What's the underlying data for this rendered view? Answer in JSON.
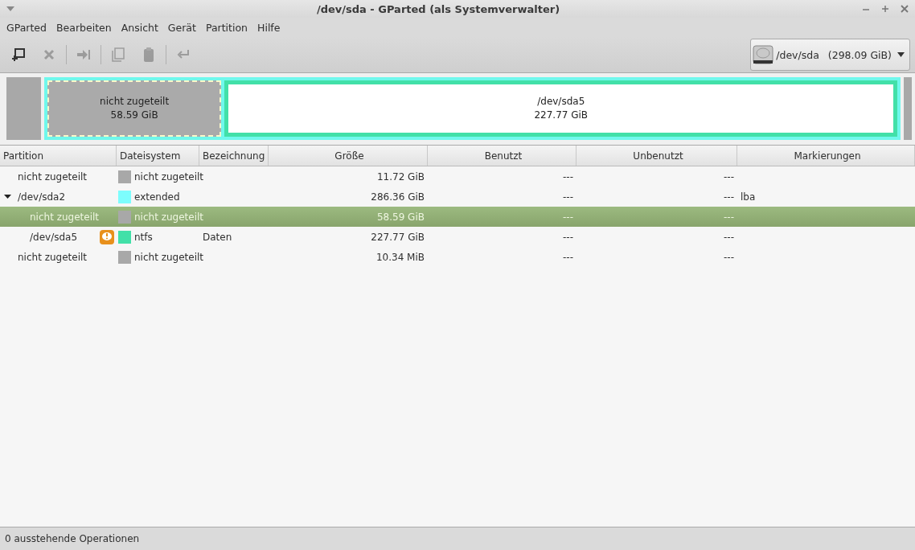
{
  "window": {
    "title": "/dev/sda - GParted (als Systemverwalter)"
  },
  "menu": [
    "GParted",
    "Bearbeiten",
    "Ansicht",
    "Gerät",
    "Partition",
    "Hilfe"
  ],
  "toolbar": [
    {
      "kind": "new",
      "disabled": false
    },
    {
      "kind": "delete",
      "disabled": true
    },
    {
      "kind": "sep"
    },
    {
      "kind": "resize",
      "disabled": true
    },
    {
      "kind": "sep"
    },
    {
      "kind": "copy",
      "disabled": true
    },
    {
      "kind": "paste",
      "disabled": true
    },
    {
      "kind": "sep"
    },
    {
      "kind": "apply",
      "disabled": true
    }
  ],
  "device": {
    "name": "/dev/sda",
    "size": "(298.09 GiB)"
  },
  "disk_map": {
    "inner": [
      {
        "name": "nicht zugeteilt",
        "size": "58.59 GiB",
        "selected": true
      },
      {
        "name": "/dev/sda5",
        "size": "227.77 GiB",
        "selected": false
      }
    ]
  },
  "table": {
    "columns": [
      "Partition",
      "Dateisystem",
      "Bezeichnung",
      "Größe",
      "Benutzt",
      "Unbenutzt",
      "Markierungen"
    ],
    "rows": [
      {
        "partition": "nicht zugeteilt",
        "filesystem": "nicht zugeteilt",
        "color": "#a8a8a8",
        "size": "11.72 GiB",
        "used": "---",
        "unused": "---",
        "selected": false,
        "warning": false
      },
      {
        "partition": "/dev/sda2",
        "filesystem": "extended",
        "color": "#7dfdfd",
        "size": "286.36 GiB",
        "used": "---",
        "unused": "---",
        "flags": "lba",
        "selected": false,
        "warning": false,
        "expanded": true,
        "children": [
          {
            "partition": "nicht zugeteilt",
            "filesystem": "nicht zugeteilt",
            "color": "#a8a8a8",
            "size": "58.59 GiB",
            "used": "---",
            "unused": "---",
            "selected": true,
            "warning": false
          },
          {
            "partition": "/dev/sda5",
            "filesystem": "ntfs",
            "color": "#42e0a8",
            "label": "Daten",
            "size": "227.77 GiB",
            "used": "---",
            "unused": "---",
            "selected": false,
            "warning": true
          }
        ]
      },
      {
        "partition": "nicht zugeteilt",
        "filesystem": "nicht zugeteilt",
        "color": "#a8a8a8",
        "size": "10.34 MiB",
        "used": "---",
        "unused": "---",
        "selected": false,
        "warning": false
      }
    ]
  },
  "status_bar": "0 ausstehende Operationen"
}
